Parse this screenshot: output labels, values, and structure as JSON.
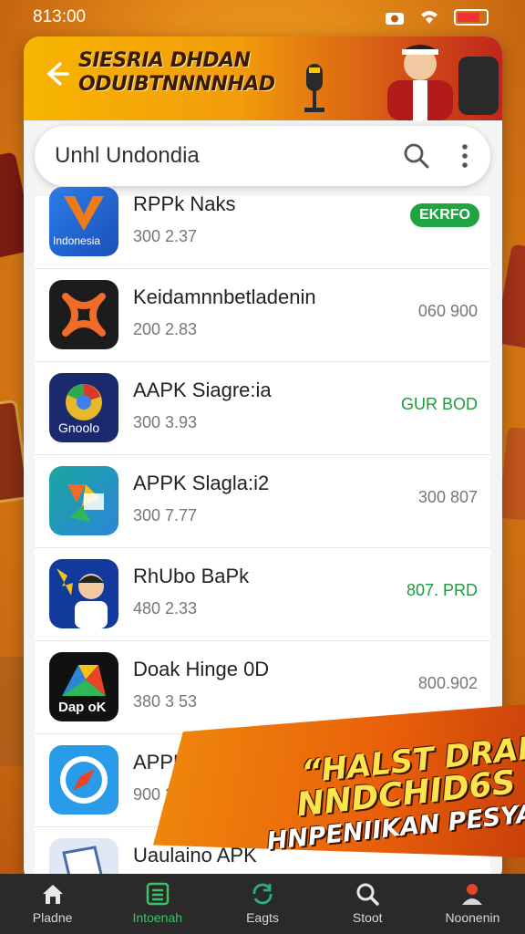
{
  "status_bar": {
    "time": "813:00"
  },
  "header": {
    "title_line1": "SIESRIA DHDAN",
    "title_line2": "ODUIBTNNNNHAD"
  },
  "search": {
    "value": "Unhl Undondia"
  },
  "apps": [
    {
      "name": "RPPk Naks",
      "meta": "300 2.37",
      "right": "EKRFO",
      "right_style": "badge"
    },
    {
      "name": "Keidamnnbetladenin",
      "meta": "200 2.83",
      "right": "060 900",
      "right_style": "gray"
    },
    {
      "name": "AAPK Siagre:ia",
      "meta": "300 3.93",
      "right": "GUR BOD",
      "right_style": "green",
      "icon_text": "Gnoolo"
    },
    {
      "name": "APPK Slagla:i2",
      "meta": "300 7.77",
      "right": "300 807",
      "right_style": "gray"
    },
    {
      "name": "RhUbo BaPk",
      "meta": "480 2.33",
      "right": "807. PRD",
      "right_style": "green"
    },
    {
      "name": "Doak Hinge 0D",
      "meta": "380 3 53",
      "right": "800.902",
      "right_style": "gray",
      "icon_text": "Dap oK"
    },
    {
      "name": "APPK APK",
      "meta": "900 3.83",
      "right": "",
      "right_style": "gray"
    },
    {
      "name": "Uaulaino APK",
      "meta": "",
      "right": "",
      "right_style": "gray"
    }
  ],
  "first_icon_text": "Indonesia",
  "promo": {
    "line1": "“HALST DRAN”",
    "line2": "NNDCHID6S",
    "line3": "HNPENIIKAN PESYA!!!"
  },
  "tabs": [
    {
      "label": "Pladne",
      "icon": "home-icon",
      "active": false
    },
    {
      "label": "Intoenah",
      "icon": "list-icon",
      "active": true
    },
    {
      "label": "Eagts",
      "icon": "refresh-icon",
      "active": false
    },
    {
      "label": "Stoot",
      "icon": "search-icon",
      "active": false
    },
    {
      "label": "Noonenin",
      "icon": "user-icon",
      "active": false
    }
  ],
  "colors": {
    "accent_green": "#21a341",
    "banner_orange": "#f29c0c",
    "tabbar": "#2a2a2a"
  }
}
